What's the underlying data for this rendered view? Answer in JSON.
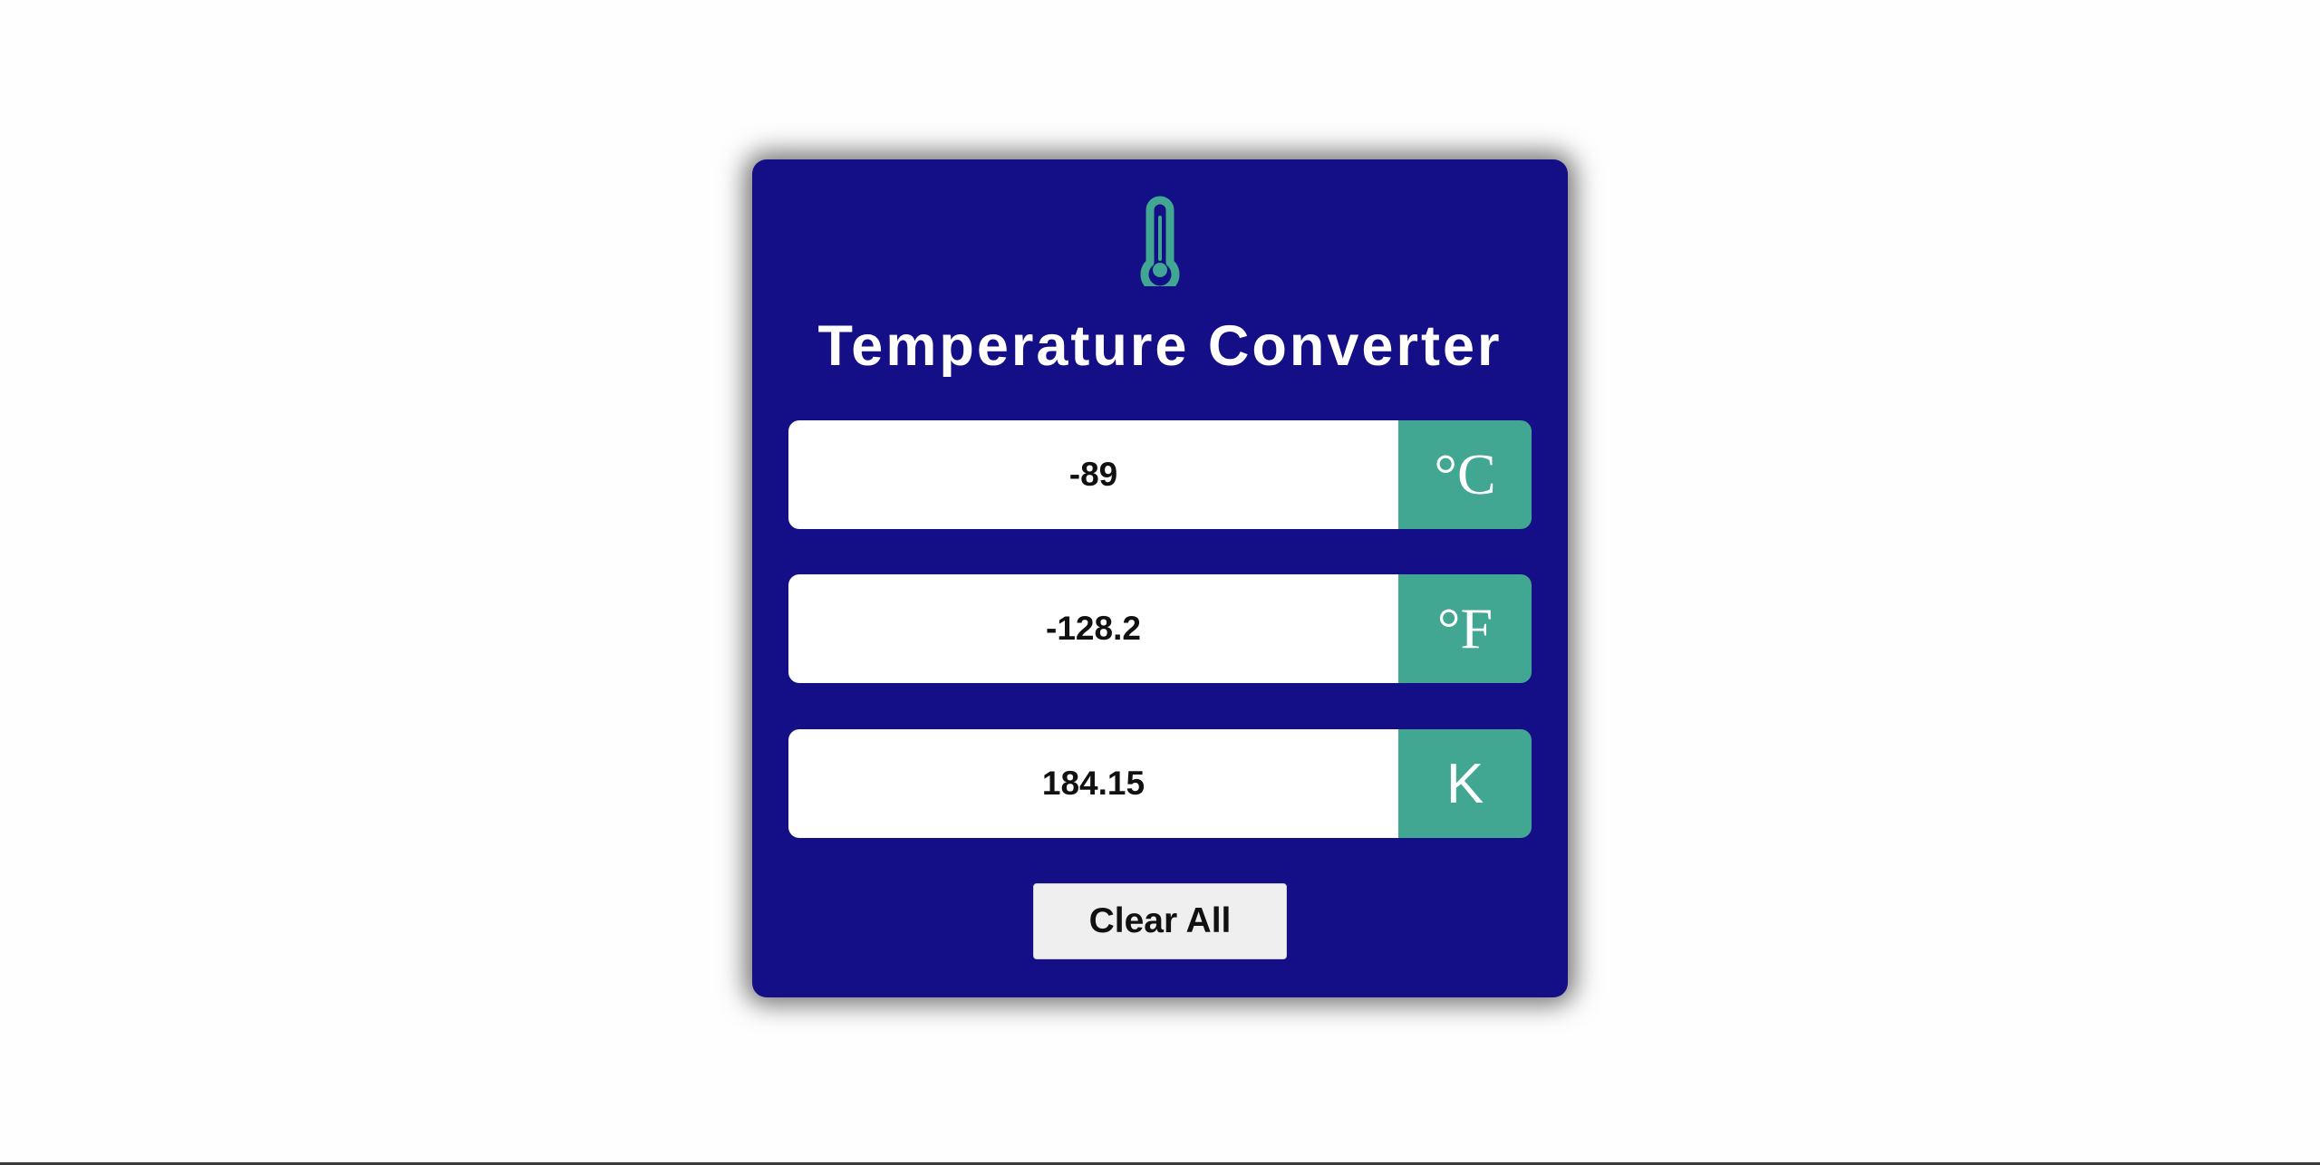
{
  "app": {
    "title": "Temperature Converter",
    "icon": "thermometer-icon"
  },
  "fields": {
    "celsius": {
      "value": "-89",
      "unit": "°C"
    },
    "fahrenheit": {
      "value": "-128.2",
      "unit": "°F"
    },
    "kelvin": {
      "value": "184.15",
      "unit": "K"
    }
  },
  "actions": {
    "clear_label": "Clear All"
  },
  "colors": {
    "card_background": "#140f87",
    "accent": "#42a792",
    "page_background": "#fefefe",
    "button_background": "#efefef"
  }
}
